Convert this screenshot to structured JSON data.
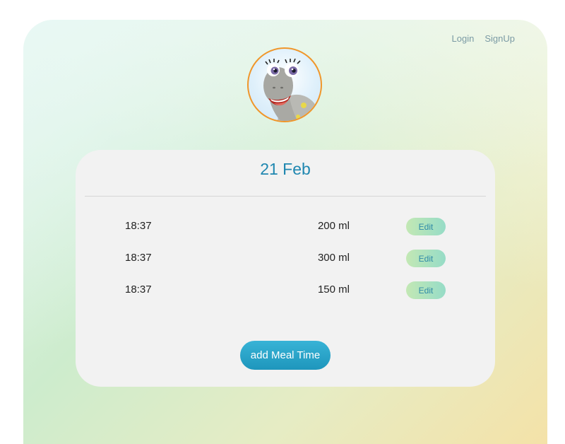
{
  "nav": {
    "login_label": "Login",
    "signup_label": "SignUp"
  },
  "avatar": {
    "icon": "dinosaur-mascot",
    "border_color": "#f0962a"
  },
  "card": {
    "date_title": "21 Feb",
    "meals": [
      {
        "time": "18:37",
        "amount": "200 ml",
        "edit_label": "Edit"
      },
      {
        "time": "18:37",
        "amount": "300 ml",
        "edit_label": "Edit"
      },
      {
        "time": "18:37",
        "amount": "150 ml",
        "edit_label": "Edit"
      }
    ],
    "add_label": "add Meal Time"
  },
  "colors": {
    "accent": "#1f87b0",
    "edit_button": "#96dcc7",
    "add_button": "#2aa5cb"
  }
}
